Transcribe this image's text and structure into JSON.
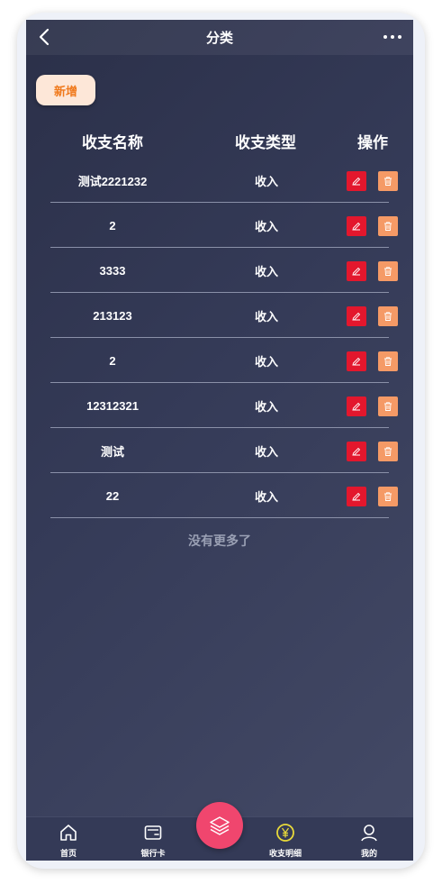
{
  "header": {
    "title": "分类"
  },
  "toolbar": {
    "add_label": "新增"
  },
  "table": {
    "columns": [
      "收支名称",
      "收支类型",
      "操作"
    ],
    "rows": [
      {
        "name": "测试2221232",
        "type": "收入"
      },
      {
        "name": "2",
        "type": "收入"
      },
      {
        "name": "3333",
        "type": "收入"
      },
      {
        "name": "213123",
        "type": "收入"
      },
      {
        "name": "2",
        "type": "收入"
      },
      {
        "name": "12312321",
        "type": "收入"
      },
      {
        "name": "测试",
        "type": "收入"
      },
      {
        "name": "22",
        "type": "收入"
      }
    ]
  },
  "footer_text": "没有更多了",
  "tabbar": {
    "items": [
      {
        "label": "首页",
        "icon": "home-icon"
      },
      {
        "label": "银行卡",
        "icon": "wallet-icon"
      },
      {
        "label": "收支明细",
        "icon": "yen-coin-icon"
      },
      {
        "label": "我的",
        "icon": "user-icon"
      }
    ],
    "center_icon": "layers-icon"
  },
  "colors": {
    "edit": "#e3172d",
    "delete": "#f59a66",
    "add_bg": "#fde7d8",
    "add_text": "#f07a1d",
    "fab": "#f0466e",
    "yen_accent": "#e8d93a"
  }
}
